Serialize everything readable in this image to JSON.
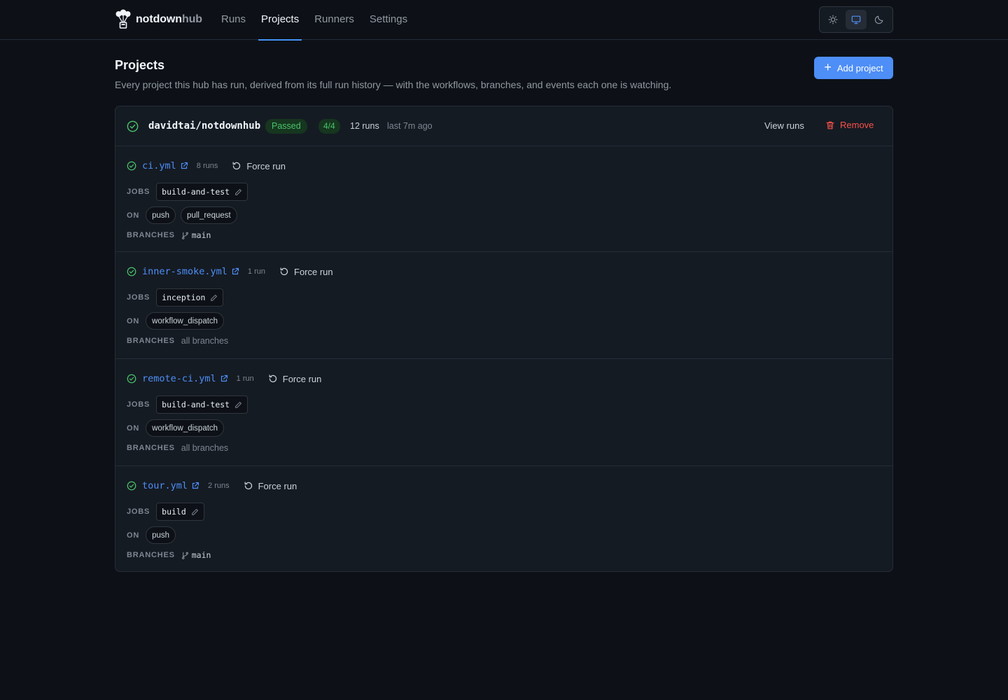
{
  "brand": {
    "name_bold": "notdown",
    "name_muted": "hub"
  },
  "nav": {
    "tabs": [
      "Runs",
      "Projects",
      "Runners",
      "Settings"
    ],
    "active": "Projects"
  },
  "theme_switch": {
    "options": [
      "sun-icon",
      "monitor-icon",
      "moon-icon"
    ],
    "selected": "monitor-icon"
  },
  "page": {
    "title": "Projects",
    "description": "Every project this hub has run, derived from its full run history — with the workflows, branches, and events each one is watching.",
    "add_button": "Add project"
  },
  "project": {
    "repo": "davidtai/notdownhub",
    "status": "Passed",
    "passed_ratio": "4/4",
    "runs": "12 runs",
    "last_run": "last 7m ago",
    "view_runs": "View runs",
    "remove": "Remove",
    "labels": {
      "jobs": "JOBS",
      "on": "ON",
      "branches": "BRANCHES",
      "force_run": "Force run"
    },
    "workflows": [
      {
        "name": "ci.yml",
        "runs": "8 runs",
        "jobs": [
          "build-and-test"
        ],
        "on": [
          "push",
          "pull_request"
        ],
        "branches": "main",
        "all_branches": false
      },
      {
        "name": "inner-smoke.yml",
        "runs": "1 run",
        "jobs": [
          "inception"
        ],
        "on": [
          "workflow_dispatch"
        ],
        "branches": "all branches",
        "all_branches": true
      },
      {
        "name": "remote-ci.yml",
        "runs": "1 run",
        "jobs": [
          "build-and-test"
        ],
        "on": [
          "workflow_dispatch"
        ],
        "branches": "all branches",
        "all_branches": true
      },
      {
        "name": "tour.yml",
        "runs": "2 runs",
        "jobs": [
          "build"
        ],
        "on": [
          "push"
        ],
        "branches": "main",
        "all_branches": false
      }
    ]
  },
  "colors": {
    "accent": "#4d8ef7",
    "success": "#4ac26b",
    "danger": "#f85149",
    "background": "#0d1117",
    "card": "#151b23"
  }
}
